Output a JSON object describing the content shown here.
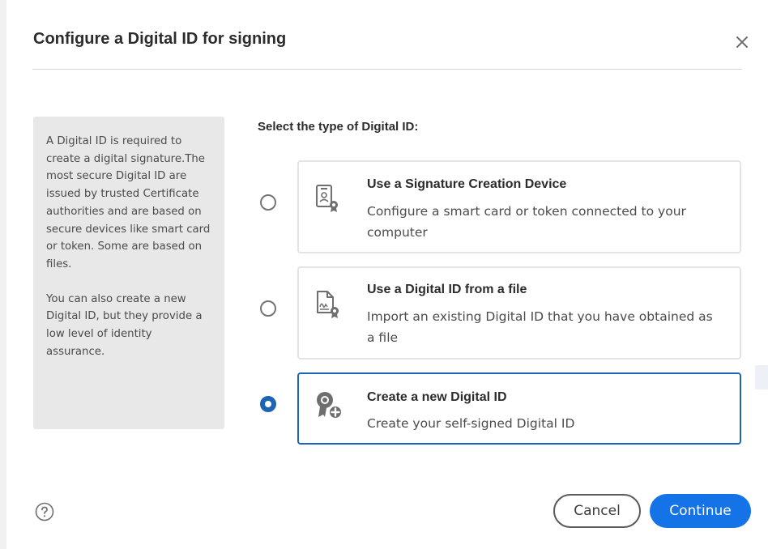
{
  "dialog": {
    "title": "Configure a Digital ID for signing",
    "close_icon": "close-icon"
  },
  "info_panel": {
    "paragraph_1": "A Digital ID is required to create a digital signature.The most secure Digital ID are issued by trusted Certificate authorities and are based on secure devices like smart card or token. Some are based on files.",
    "paragraph_2": "You can also create a new Digital ID, but they provide a low level of identity assurance."
  },
  "select_label": "Select the type of Digital ID:",
  "options": [
    {
      "title": "Use a Signature Creation Device",
      "description": "Configure a smart card or token connected to your computer",
      "icon": "signature-device-icon",
      "selected": false
    },
    {
      "title": "Use a Digital ID from a file",
      "description": "Import an existing Digital ID that you have obtained as a file",
      "icon": "digital-id-file-icon",
      "selected": false
    },
    {
      "title": "Create a new Digital ID",
      "description": "Create your self-signed Digital ID",
      "icon": "create-digital-id-icon",
      "selected": true
    }
  ],
  "footer": {
    "help_icon": "help-icon",
    "cancel_label": "Cancel",
    "continue_label": "Continue"
  },
  "colors": {
    "accent": "#1473e6",
    "selected_border": "#1e64b4",
    "info_panel_bg": "#e8e8e8"
  }
}
